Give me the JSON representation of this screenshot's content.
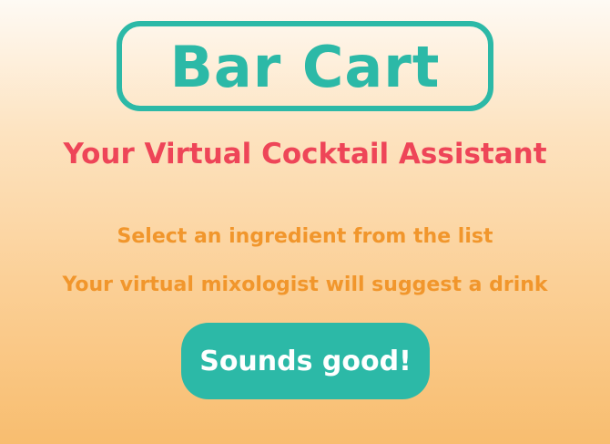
{
  "app": {
    "title": "Bar Cart",
    "tagline": "Your Virtual Cocktail Assistant"
  },
  "instructions": [
    "Select an ingredient from the list",
    "Your virtual mixologist will suggest a drink"
  ],
  "cta": {
    "label": "Sounds good!"
  },
  "colors": {
    "accent": "#2cb9a7",
    "tagline": "#ee4558",
    "instruction": "#f1962c"
  }
}
